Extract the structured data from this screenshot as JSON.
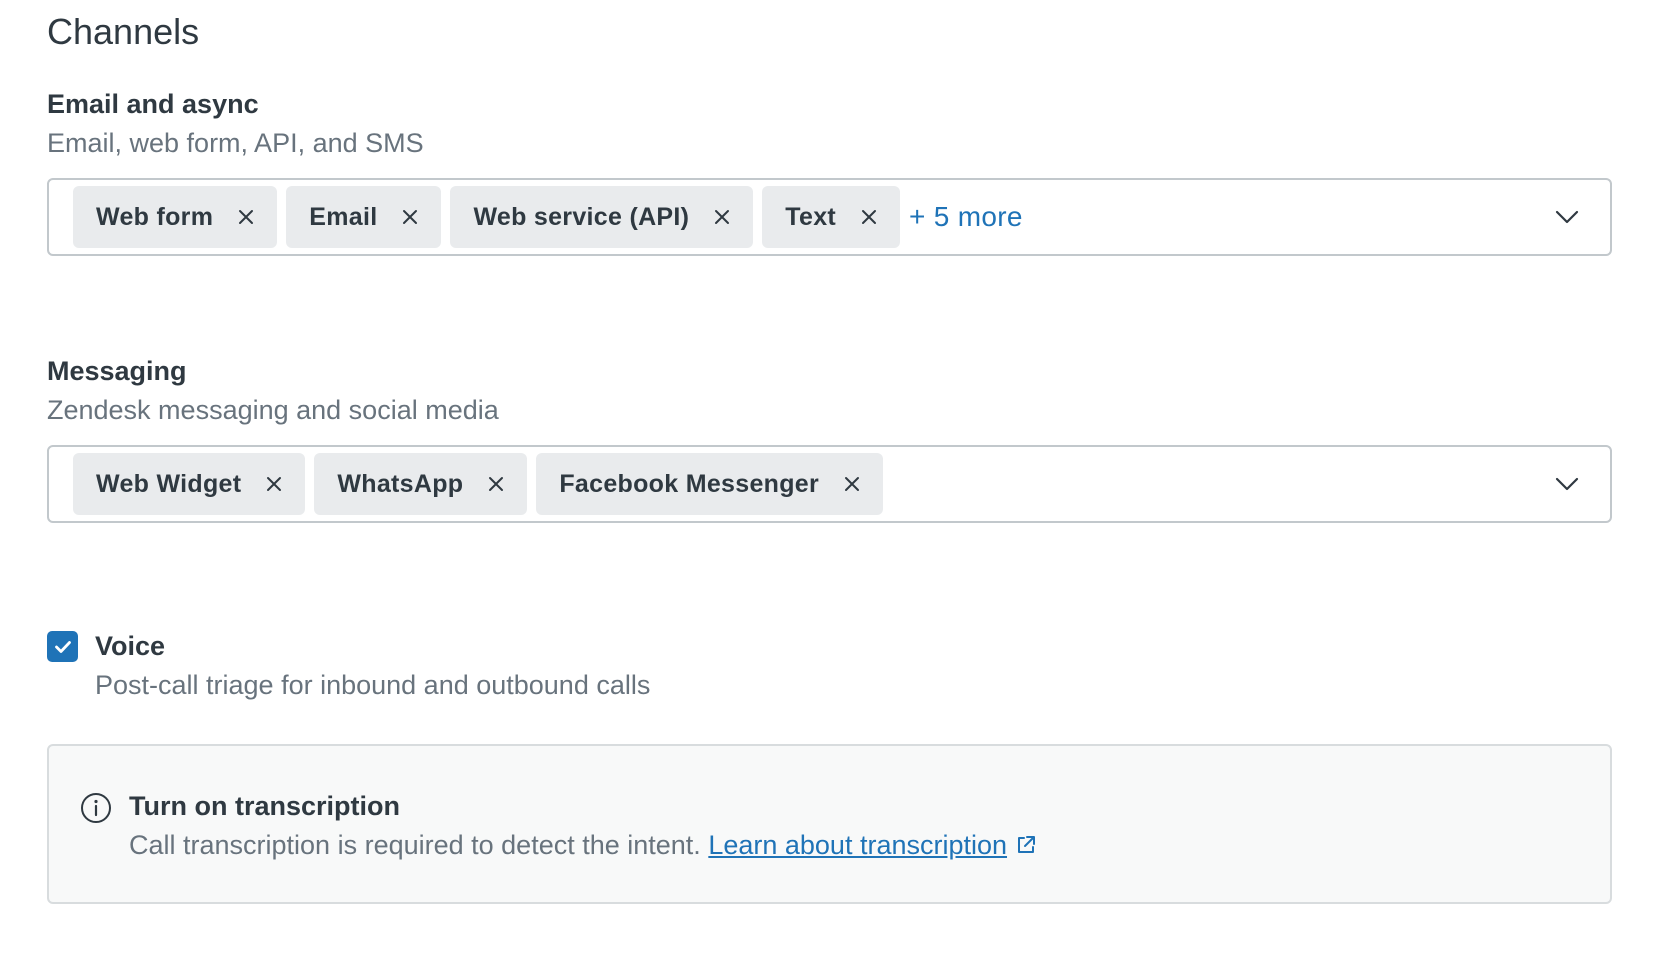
{
  "page": {
    "title": "Channels"
  },
  "email_async": {
    "title": "Email and async",
    "description": "Email, web form, API, and SMS",
    "tags": [
      "Web form",
      "Email",
      "Web service (API)",
      "Text"
    ],
    "more_label": "+ 5 more"
  },
  "messaging": {
    "title": "Messaging",
    "description": "Zendesk messaging and social media",
    "tags": [
      "Web Widget",
      "WhatsApp",
      "Facebook Messenger"
    ]
  },
  "voice": {
    "checked": true,
    "label": "Voice",
    "description": "Post-call triage for inbound and outbound calls"
  },
  "notice": {
    "icon": "info-icon",
    "title": "Turn on transcription",
    "body": "Call transcription is required to detect the intent.",
    "link_label": "Learn about transcription",
    "link_icon": "external-link-icon"
  },
  "colors": {
    "accent": "#1f73b7",
    "tag_bg": "#e9ebed",
    "text": "#2f3941",
    "muted": "#68737d",
    "border": "#c2c8cc",
    "notice_bg": "#f8f9f9"
  }
}
